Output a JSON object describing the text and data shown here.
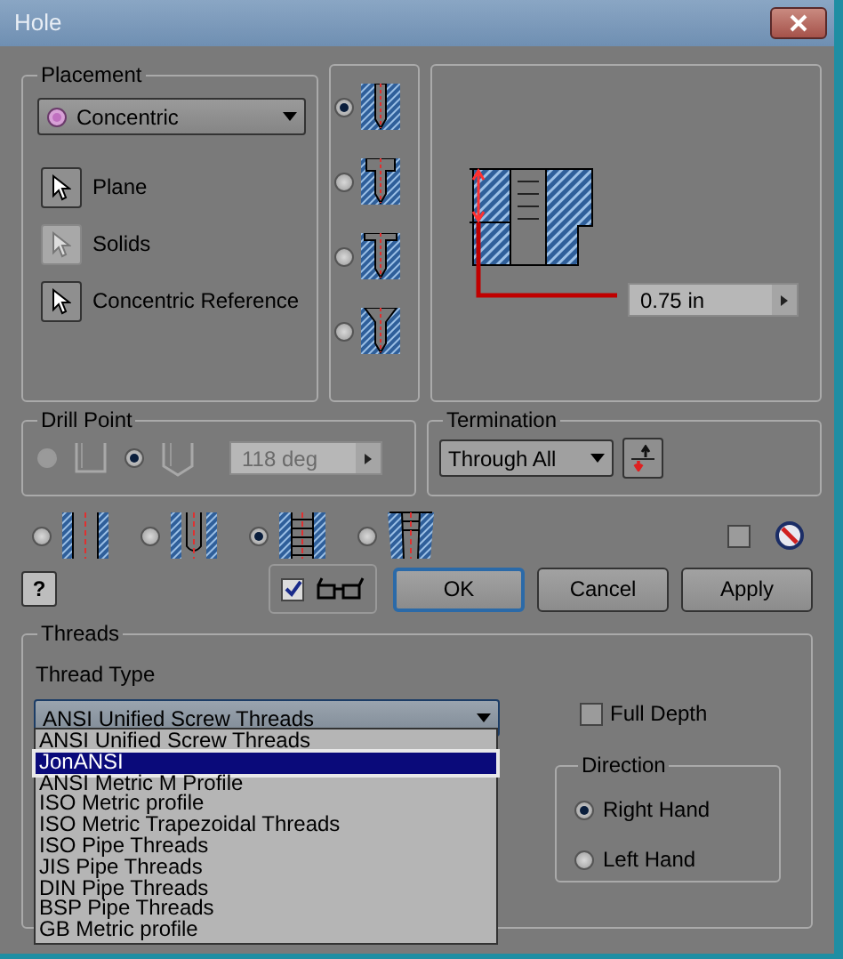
{
  "window": {
    "title": "Hole"
  },
  "placement": {
    "title": "Placement",
    "mode": "Concentric",
    "references": [
      {
        "label": "Plane",
        "disabled": false
      },
      {
        "label": "Solids",
        "disabled": true
      },
      {
        "label": "Concentric Reference",
        "disabled": false
      }
    ]
  },
  "hole_types": [
    {
      "kind": "drilled",
      "selected": true
    },
    {
      "kind": "counterbore",
      "selected": false
    },
    {
      "kind": "spotface",
      "selected": false
    },
    {
      "kind": "countersink",
      "selected": false
    }
  ],
  "preview": {
    "depth": "0.75 in"
  },
  "drill_point": {
    "title": "Drill Point",
    "options": [
      {
        "kind": "flat",
        "selected": false,
        "disabled": true
      },
      {
        "kind": "angle",
        "selected": true,
        "disabled": false
      }
    ],
    "angle": "118 deg"
  },
  "termination": {
    "title": "Termination",
    "value": "Through All"
  },
  "thread_options": [
    {
      "kind": "simple",
      "selected": false
    },
    {
      "kind": "clearance",
      "selected": false
    },
    {
      "kind": "tapped",
      "selected": true
    },
    {
      "kind": "taper",
      "selected": false
    }
  ],
  "ipart_checkbox": {
    "checked": false
  },
  "help": {
    "label": "?"
  },
  "preview_toggle": {
    "checked": true
  },
  "buttons": [
    {
      "label": "OK",
      "default": true
    },
    {
      "label": "Cancel",
      "default": false
    },
    {
      "label": "Apply",
      "default": false
    }
  ],
  "threads": {
    "title": "Threads",
    "thread_type_label": "Thread Type",
    "thread_type": "ANSI Unified Screw Threads",
    "options": [
      {
        "label": "ANSI Unified Screw Threads",
        "selected": false
      },
      {
        "label": "JonANSI",
        "selected": true
      },
      {
        "label": "ANSI Metric M Profile",
        "selected": false
      },
      {
        "label": "ISO Metric profile",
        "selected": false
      },
      {
        "label": "ISO Metric Trapezoidal Threads",
        "selected": false
      },
      {
        "label": "ISO Pipe Threads",
        "selected": false
      },
      {
        "label": "JIS Pipe Threads",
        "selected": false
      },
      {
        "label": "DIN Pipe Threads",
        "selected": false
      },
      {
        "label": "BSP Pipe Threads",
        "selected": false
      },
      {
        "label": "GB Metric profile",
        "selected": false
      }
    ],
    "full_depth": {
      "label": "Full Depth",
      "checked": false
    },
    "direction": {
      "title": "Direction",
      "options": [
        {
          "label": "Right Hand",
          "selected": true
        },
        {
          "label": "Left Hand",
          "selected": false
        }
      ]
    }
  }
}
